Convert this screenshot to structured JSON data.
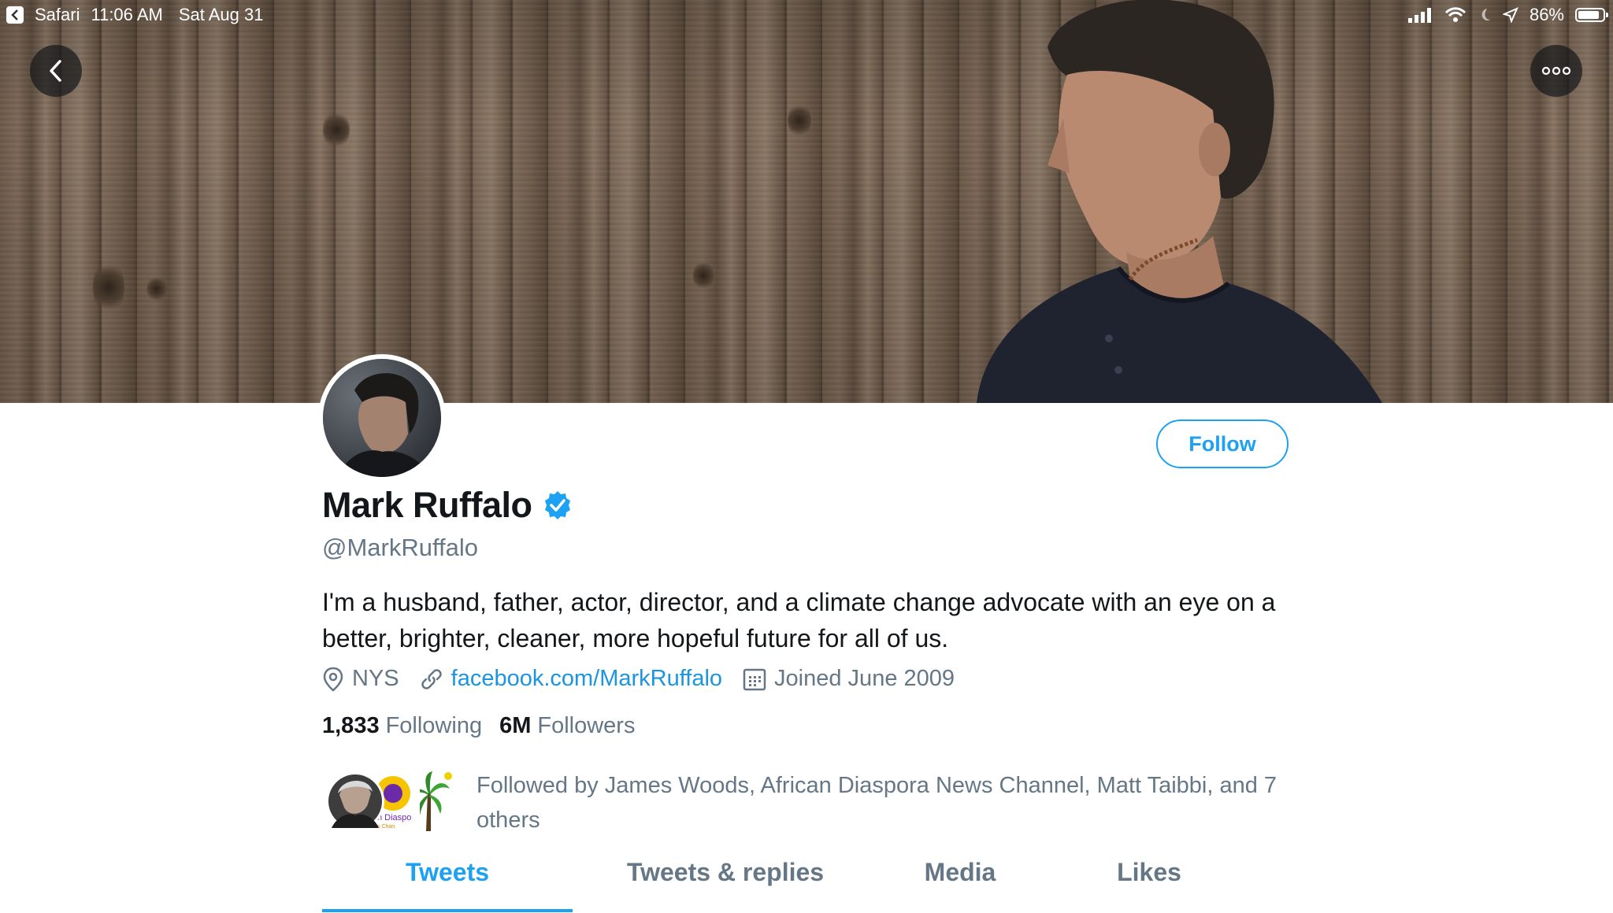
{
  "status_bar": {
    "app": "Safari",
    "time": "11:06 AM",
    "date": "Sat Aug 31",
    "battery": "86%",
    "battery_level": 0.86
  },
  "nav": {
    "back_icon": "chevron-left-icon",
    "more_icon": "more-dots-icon"
  },
  "profile": {
    "name": "Mark Ruffalo",
    "verified_icon": "verified-badge-icon",
    "handle": "@MarkRuffalo",
    "bio": "I'm a husband, father, actor, director, and a climate change advocate with an eye on a better, brighter, cleaner, more hopeful future for all of us.",
    "location": "NYS",
    "website": "facebook.com/MarkRuffalo",
    "joined": "Joined June 2009",
    "follow_label": "Follow"
  },
  "stats": {
    "following_count": "1,833",
    "following_label": "Following",
    "followers_count": "6M",
    "followers_label": "Followers"
  },
  "followed_by": {
    "text": "Followed by James Woods, African Diaspora News Channel, Matt Taibbi, and 7 others"
  },
  "tabs": [
    {
      "label": "Tweets",
      "active": true
    },
    {
      "label": "Tweets & replies",
      "active": false
    },
    {
      "label": "Media",
      "active": false
    },
    {
      "label": "Likes",
      "active": false
    }
  ],
  "colors": {
    "accent": "#1da1f2",
    "link": "#1b95e0",
    "muted": "#657786",
    "text": "#14171a"
  }
}
